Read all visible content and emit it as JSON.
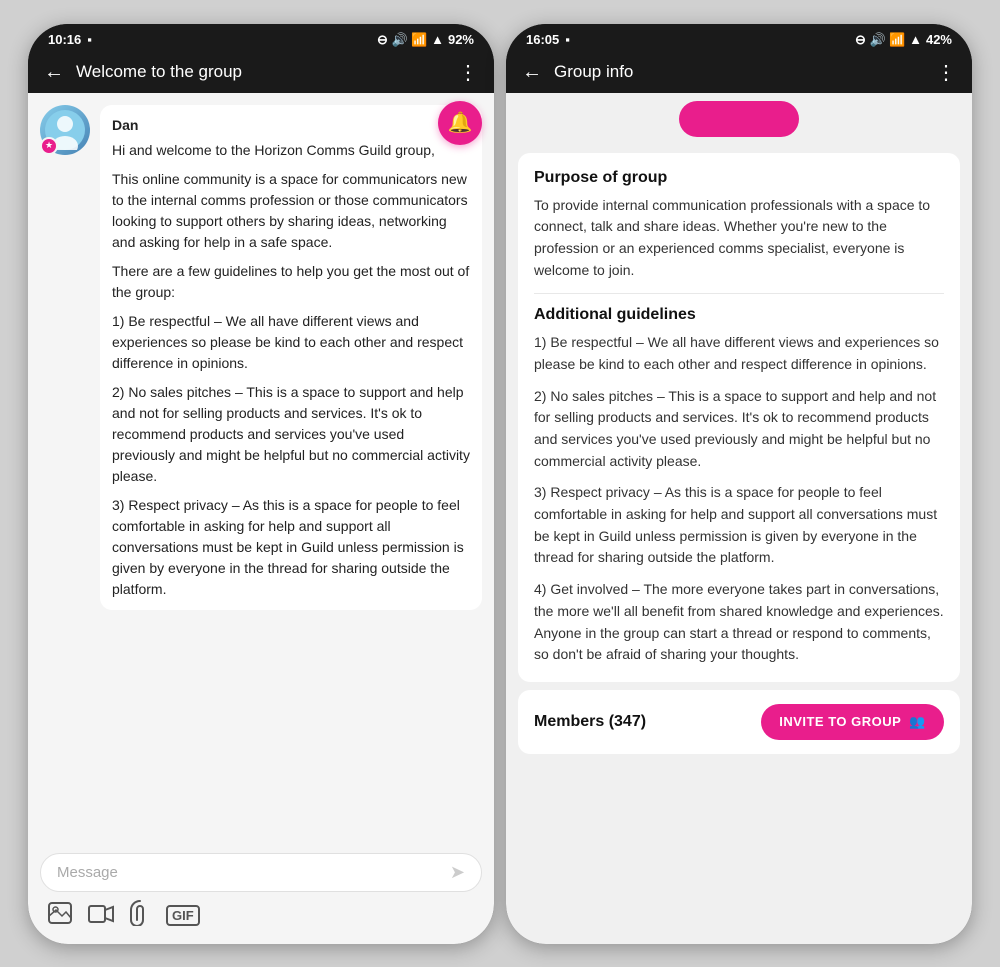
{
  "left_phone": {
    "status_bar": {
      "time": "10:16",
      "battery": "92%",
      "icons": "⊖📷🔊📶▲"
    },
    "top_bar": {
      "title": "Welcome to the group",
      "back_label": "←",
      "more_label": "⋮"
    },
    "message": {
      "sender": "Dan",
      "paragraphs": [
        "Hi and welcome to the Horizon Comms Guild group,",
        "This online community is a space for communicators new to the internal comms profession or those communicators looking to support others by sharing ideas, networking and asking for help in a safe space.",
        "There are a few guidelines to help you get the most out of the group:",
        "1) Be respectful – We all have different views and experiences so please be kind to each other and respect difference in opinions.",
        "2) No sales pitches – This is a space to support and help and not for selling products and services. It's ok to recommend products and services you've used previously and might be helpful but no commercial activity please.",
        "3) Respect privacy – As this is a space for people to feel comfortable in asking for help and support all conversations must be kept in Guild unless permission is given by everyone in the thread for sharing outside the platform."
      ]
    },
    "input_bar": {
      "placeholder": "Message",
      "send_icon": "➤"
    },
    "toolbar": {
      "image_icon": "🖼",
      "video_icon": "📹",
      "attachment_icon": "📎",
      "gif_icon": "GIF"
    }
  },
  "right_phone": {
    "status_bar": {
      "time": "16:05",
      "battery": "42%",
      "icons": "⊖📷🔊📶▲"
    },
    "top_bar": {
      "title": "Group info",
      "back_label": "←",
      "more_label": "⋮"
    },
    "purpose_section": {
      "title": "Purpose of group",
      "text": "To provide internal communication professionals with a space to connect, talk and share ideas. Whether you're new to the profession or an experienced comms specialist, everyone is welcome to join."
    },
    "guidelines_section": {
      "title": "Additional guidelines",
      "items": [
        "1)  Be respectful – We all have different views and experiences so please be kind to each other and respect difference in opinions.",
        "2)  No sales pitches – This is a space to support and help and not for selling products and services. It's ok to recommend products and services you've used previously and might be helpful but no commercial activity please.",
        "3)  Respect privacy – As this is a space for people to feel comfortable in asking for help and support all conversations must be kept in Guild unless permission is given by everyone in the thread for sharing outside the platform.",
        "4)  Get involved – The more everyone takes part in conversations, the more we'll all benefit from shared knowledge and experiences. Anyone in the group can start a thread or respond to comments, so don't be afraid of sharing your thoughts."
      ]
    },
    "members_bar": {
      "label": "Members",
      "count": "(347)",
      "invite_button": "INVITE TO GROUP",
      "invite_icon": "👥"
    }
  }
}
